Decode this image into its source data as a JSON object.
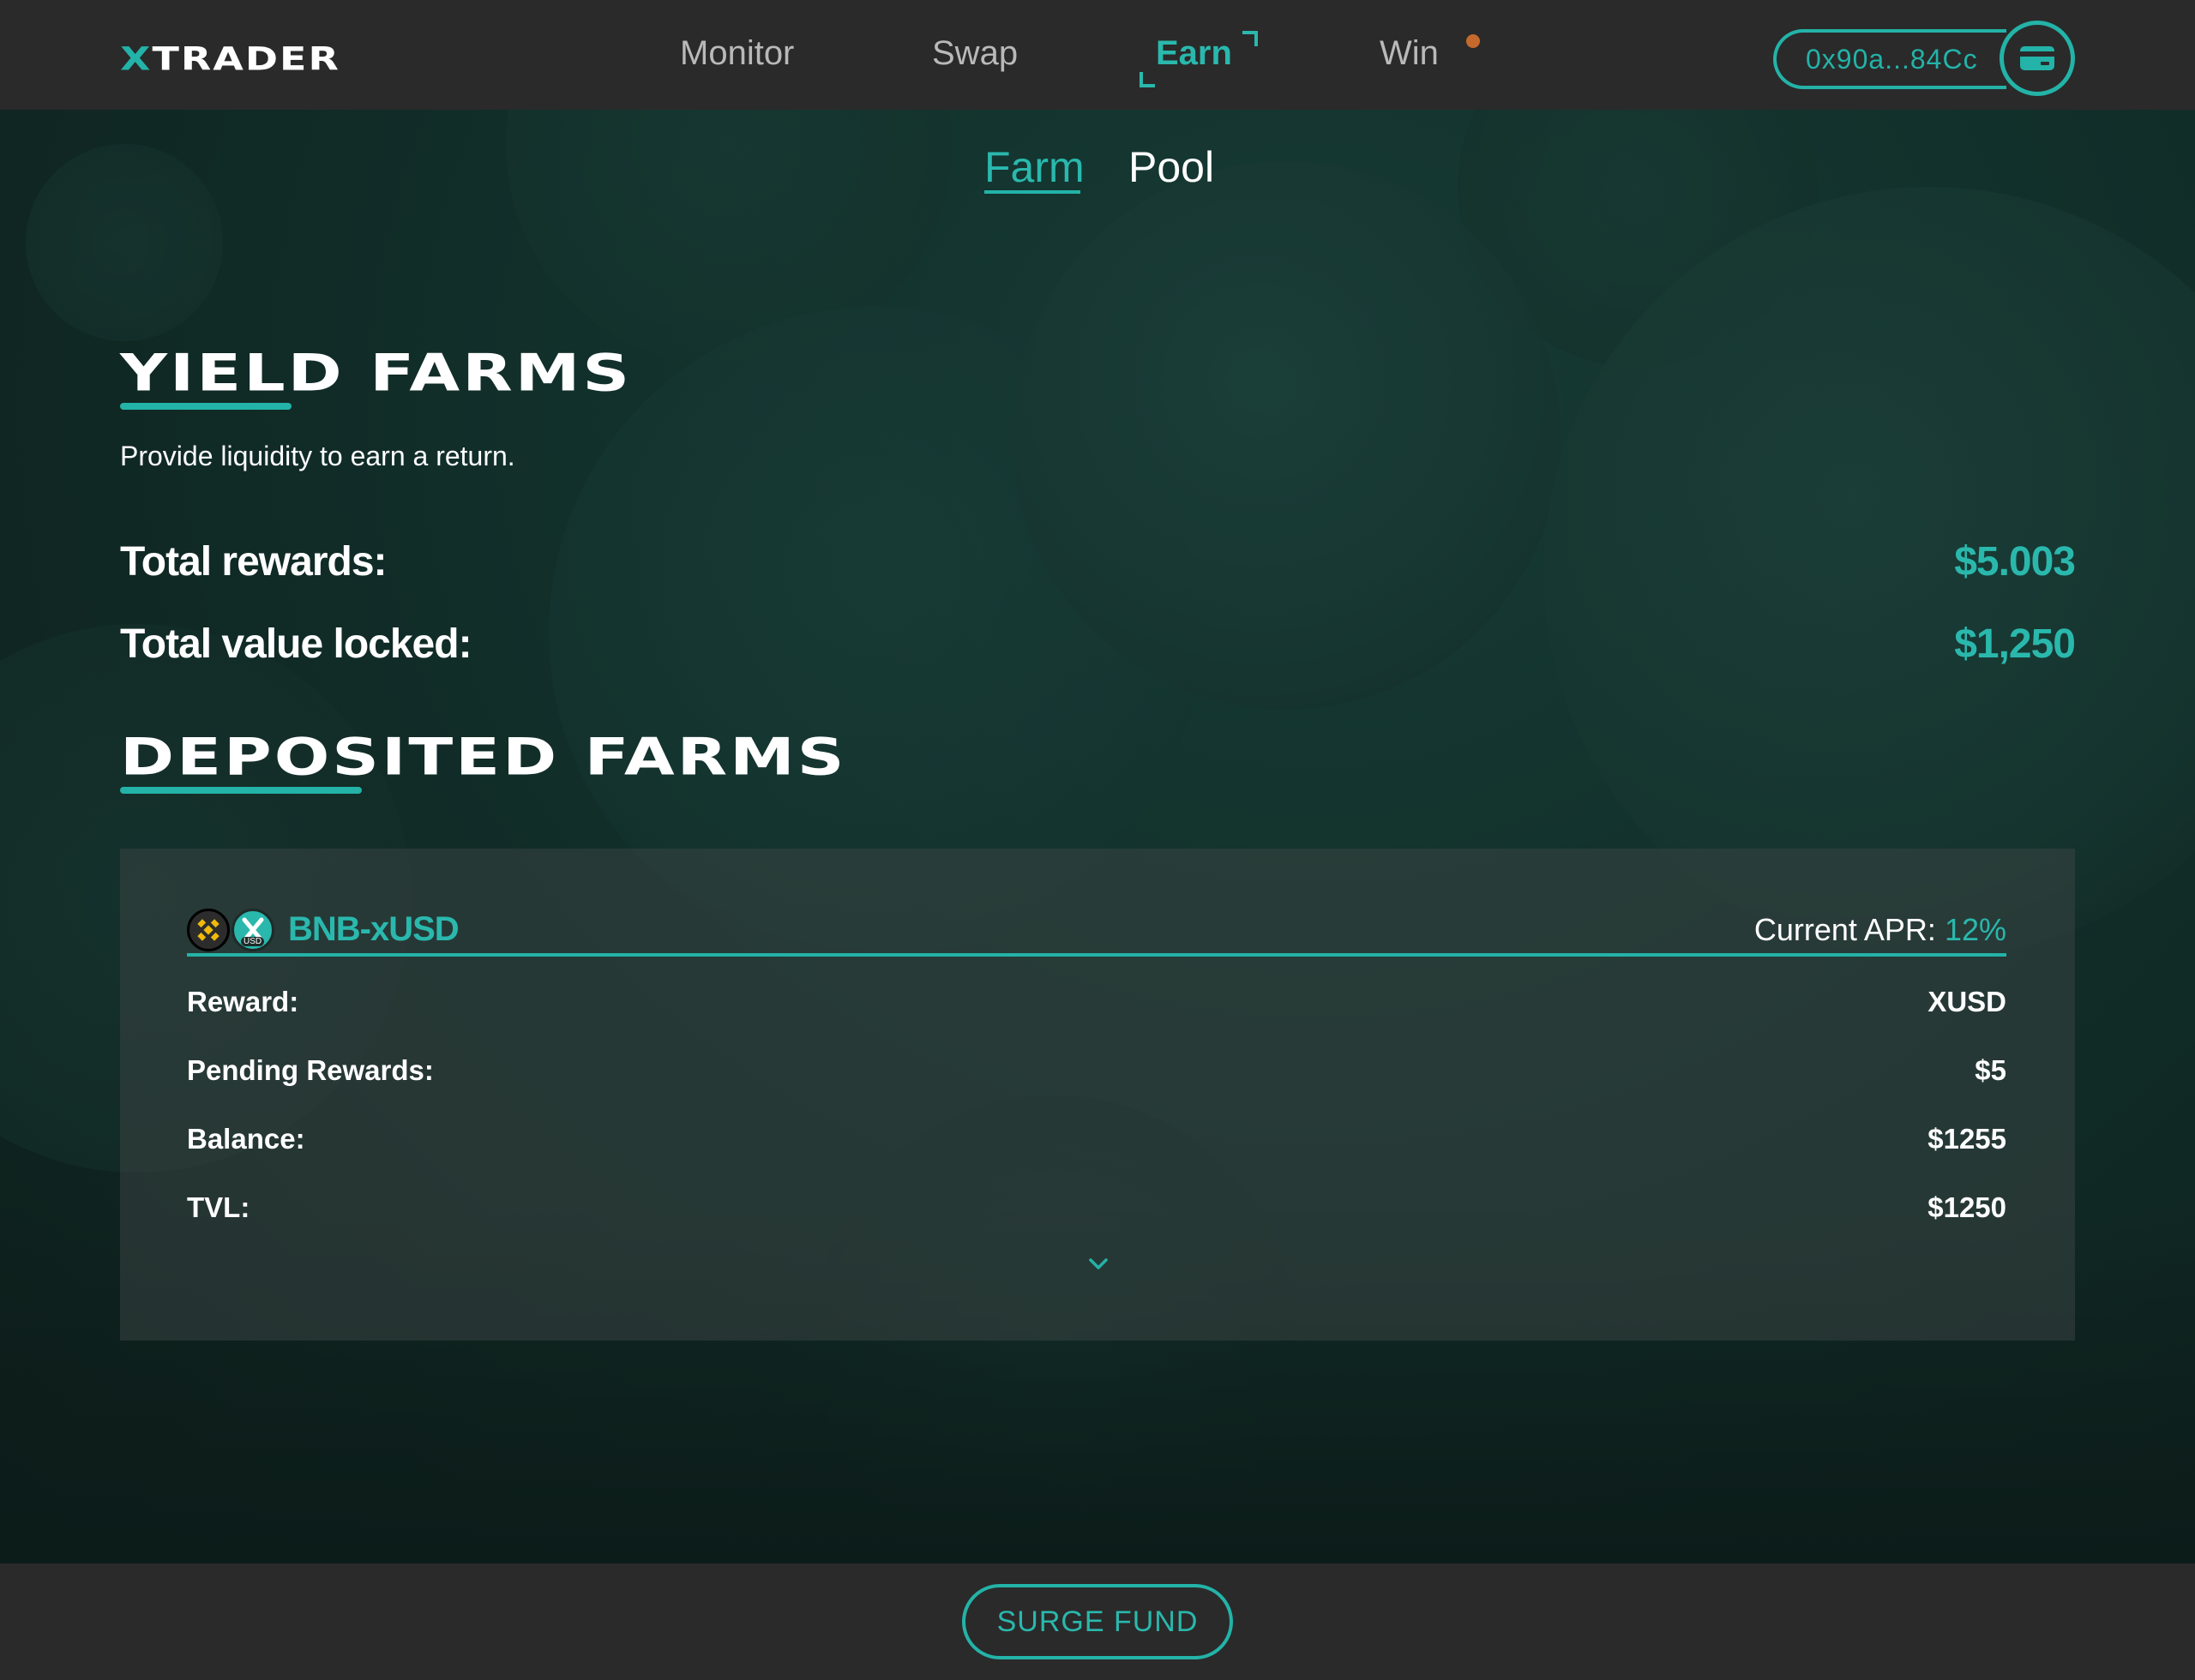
{
  "app": {
    "logo_x": "X",
    "logo_rest": "TRADER"
  },
  "nav": {
    "items": [
      {
        "label": "Monitor"
      },
      {
        "label": "Swap"
      },
      {
        "label": "Earn"
      },
      {
        "label": "Win"
      }
    ],
    "active": "Earn"
  },
  "wallet": {
    "address": "0x90a...84Cc"
  },
  "subtabs": {
    "items": [
      {
        "label": "Farm"
      },
      {
        "label": "Pool"
      }
    ],
    "active": "Farm"
  },
  "yield": {
    "title": "YIELD FARMS",
    "subtitle": "Provide liquidity to earn a return.",
    "total_rewards_label": "Total rewards:",
    "total_rewards_value": "$5.003",
    "tvl_label": "Total value locked:",
    "tvl_value": "$1,250"
  },
  "deposited": {
    "title": "DEPOSITED FARMS",
    "farms": [
      {
        "pair": "BNB-xUSD",
        "apr_label": "Current APR:",
        "apr_value": "12%",
        "reward_label": "Reward:",
        "reward_value": "XUSD",
        "pending_label": "Pending Rewards:",
        "pending_value": "$5",
        "balance_label": "Balance:",
        "balance_value": "$1255",
        "tvl_label": "TVL:",
        "tvl_value": "$1250",
        "coin_badge": "USD"
      }
    ]
  },
  "footer": {
    "surge_label": "SURGE FUND"
  },
  "colors": {
    "accent": "#23b3a8",
    "header_bg": "#2a2a2a",
    "win_dot": "#c56a2c",
    "bnb_gold": "#f0b90b"
  }
}
